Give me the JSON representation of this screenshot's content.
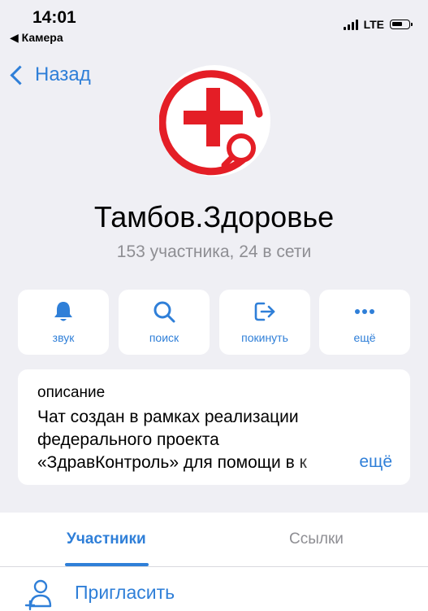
{
  "status_bar": {
    "time": "14:01",
    "back_app": "◀ Камера",
    "network": "LTE"
  },
  "nav": {
    "back_label": "Назад"
  },
  "profile": {
    "title": "Тамбов.Здоровье",
    "subtitle": "153 участника, 24 в сети",
    "avatar_icon": "red-cross-magnifier-logo"
  },
  "actions": [
    {
      "icon": "bell-icon",
      "label": "звук"
    },
    {
      "icon": "search-icon",
      "label": "поиск"
    },
    {
      "icon": "leave-icon",
      "label": "покинуть"
    },
    {
      "icon": "more-icon",
      "label": "ещё"
    }
  ],
  "description": {
    "title": "описание",
    "lines": [
      "Чат создан в рамках реализации",
      "федерального проекта",
      "«ЗдравКонтроль» для помощи в к"
    ],
    "more_label": "ещё"
  },
  "tabs": [
    {
      "label": "Участники",
      "active": true
    },
    {
      "label": "Ссылки",
      "active": false
    }
  ],
  "invite": {
    "label": "Пригласить",
    "icon": "add-user-icon"
  },
  "colors": {
    "accent": "#2f7fd8",
    "background": "#efeff4",
    "brand_red": "#e41e26"
  }
}
